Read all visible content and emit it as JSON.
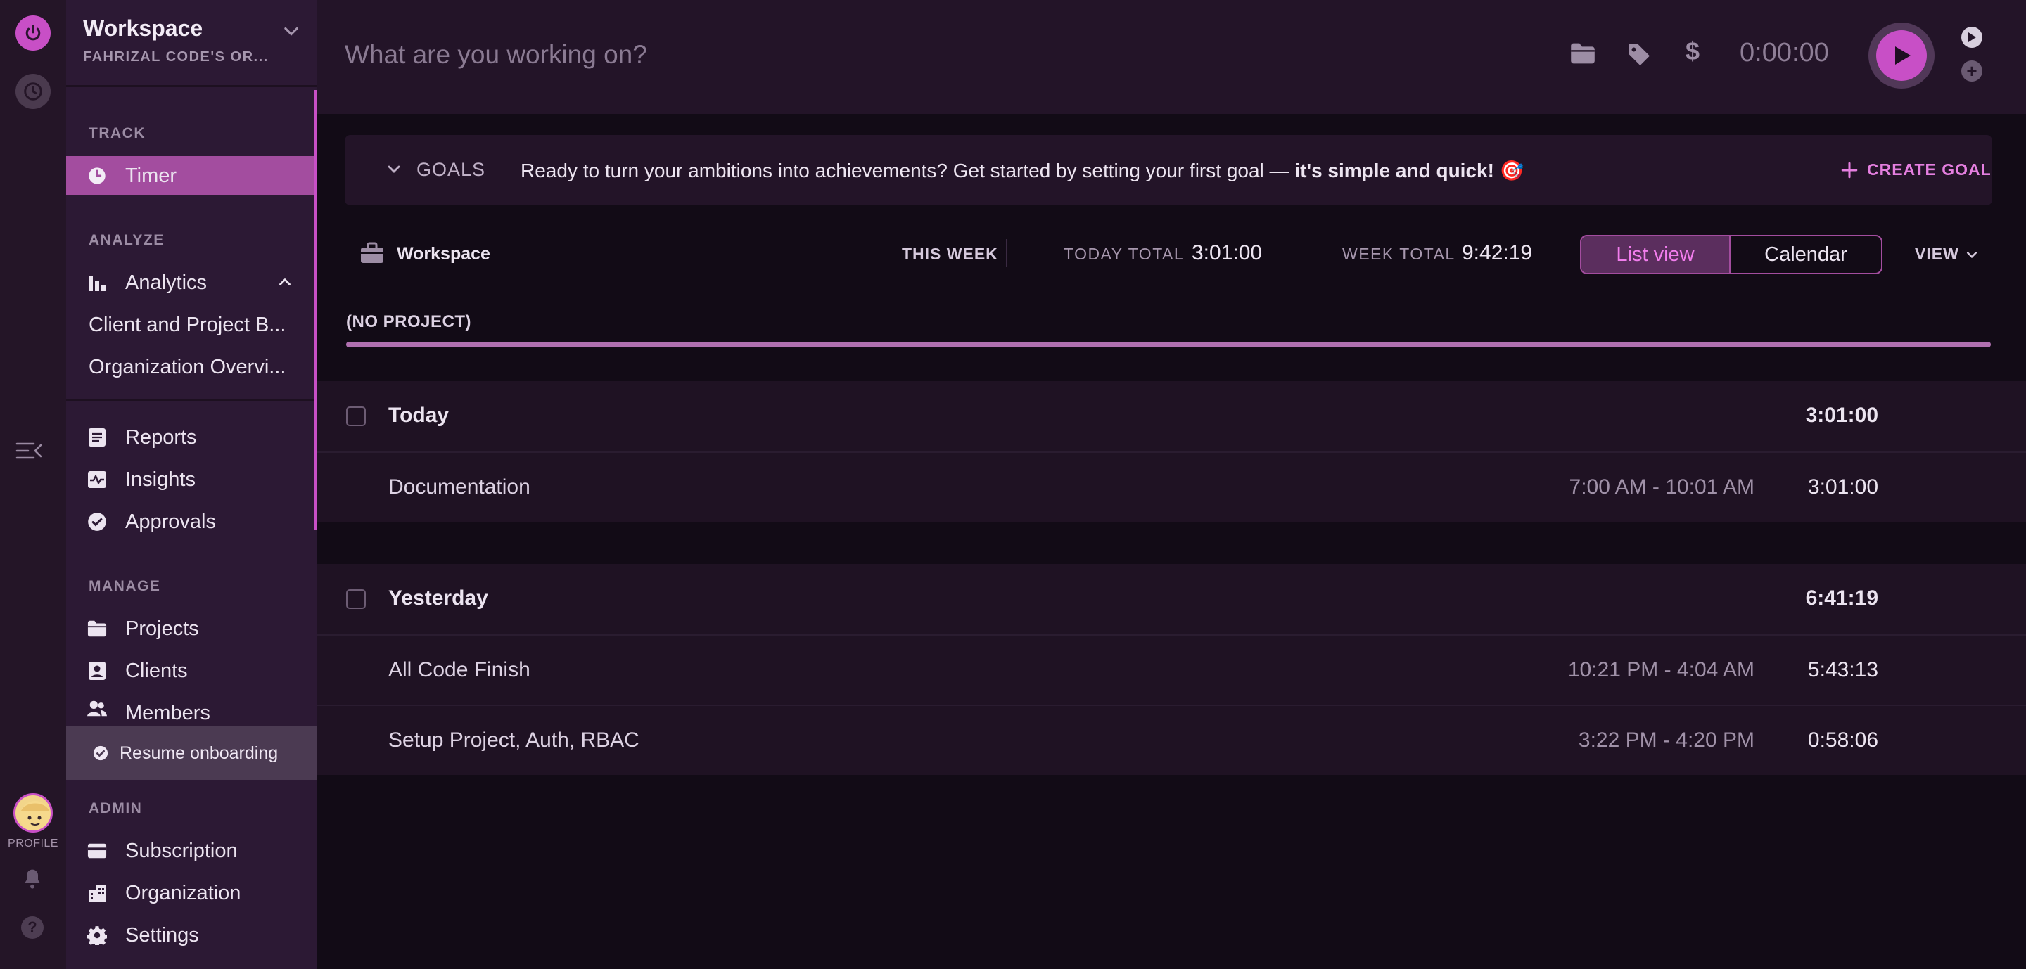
{
  "workspace": {
    "name": "Workspace",
    "org": "FAHRIZAL CODE'S OR..."
  },
  "rail": {
    "profile_label": "PROFILE"
  },
  "sidebar": {
    "track_title": "TRACK",
    "timer": "Timer",
    "analyze_title": "ANALYZE",
    "analytics": "Analytics",
    "analytics_sub": [
      "Client and Project B...",
      "Organization Overvi..."
    ],
    "reports": "Reports",
    "insights": "Insights",
    "approvals": "Approvals",
    "manage_title": "MANAGE",
    "projects": "Projects",
    "clients": "Clients",
    "members": "Members",
    "resume": "Resume onboarding",
    "admin_title": "ADMIN",
    "subscription": "Subscription",
    "organization": "Organization",
    "settings": "Settings"
  },
  "topbar": {
    "placeholder": "What are you working on?",
    "timer": "0:00:00"
  },
  "goals": {
    "label": "GOALS",
    "message": "Ready to turn your ambitions into achievements? Get started by setting your first goal — ",
    "message_bold": "it's simple and quick! 🎯",
    "create": "CREATE GOAL"
  },
  "filters": {
    "workspace": "Workspace",
    "week": "THIS WEEK",
    "today_total_label": "TODAY TOTAL",
    "today_total": "3:01:00",
    "week_total_label": "WEEK TOTAL",
    "week_total": "9:42:19",
    "list_view": "List view",
    "calendar": "Calendar",
    "view": "VIEW"
  },
  "project": {
    "label": "(NO PROJECT)"
  },
  "days": [
    {
      "label": "Today",
      "total": "3:01:00",
      "entries": [
        {
          "desc": "Documentation",
          "range": "7:00 AM - 10:01 AM",
          "duration": "3:01:00"
        }
      ]
    },
    {
      "label": "Yesterday",
      "total": "6:41:19",
      "entries": [
        {
          "desc": "All Code Finish",
          "range": "10:21 PM - 4:04 AM",
          "duration": "5:43:13"
        },
        {
          "desc": "Setup Project, Auth, RBAC",
          "range": "3:22 PM - 4:20 PM",
          "duration": "0:58:06"
        }
      ]
    }
  ],
  "colors": {
    "accent": "#c84fc6",
    "accent_text": "#f27ded",
    "background": "#120b16",
    "sidebar": "#2c1934"
  }
}
